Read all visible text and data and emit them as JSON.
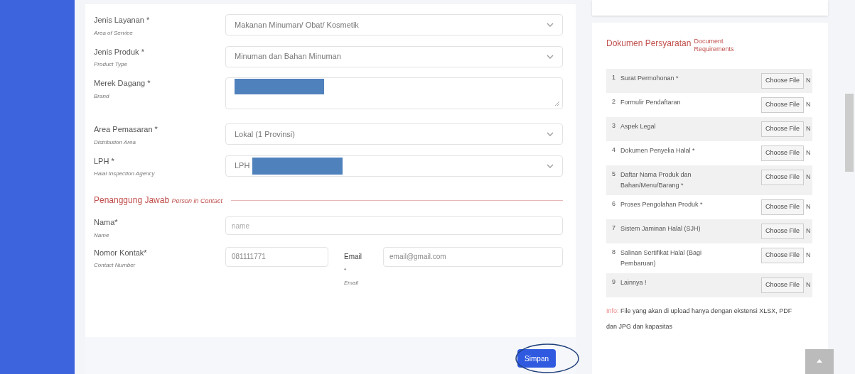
{
  "form": {
    "fields": [
      {
        "kind": "select",
        "label": "Jenis Layanan *",
        "sublabel": "Area of Service",
        "value": "Makanan Minuman/ Obat/ Kosmetik"
      },
      {
        "kind": "select",
        "label": "Jenis Produk *",
        "sublabel": "Product Type",
        "value": "Minuman dan Bahan Minuman"
      },
      {
        "kind": "textarea",
        "label": "Merek Dagang *",
        "sublabel": "Brand",
        "redacted": true
      },
      {
        "kind": "select",
        "label": "Area Pemasaran *",
        "sublabel": "Distribution Area",
        "value": "Lokal (1 Provinsi)"
      },
      {
        "kind": "select",
        "label": "LPH *",
        "sublabel": "Halal Inspection Agency",
        "value": "LPH",
        "redacted": true
      }
    ],
    "section": {
      "title": "Penanggung Jawab",
      "subtitle": "Person in Contact"
    },
    "contact": {
      "name": {
        "label": "Nama*",
        "sublabel": "Name",
        "placeholder": "name"
      },
      "phone": {
        "label": "Nomor Kontak*",
        "sublabel": "Contact Number",
        "value": "081111771"
      },
      "email": {
        "label": "Email",
        "star": "*",
        "sublabel": "Email",
        "value": "email@gmail.com"
      }
    },
    "submit": "Simpan"
  },
  "documents": {
    "title": "Dokumen Persyaratan",
    "subtitle": "Document Requirements",
    "rows": [
      {
        "number": "1",
        "name": "Surat Permohonan *",
        "button": "Choose File",
        "status": "N"
      },
      {
        "number": "2",
        "name": "Formulir Pendaftaran",
        "button": "Choose File",
        "status": "N"
      },
      {
        "number": "3",
        "name": "Aspek Legal",
        "button": "Choose File",
        "status": "N"
      },
      {
        "number": "4",
        "name": "Dokumen Penyelia Halal *",
        "button": "Choose File",
        "status": "N"
      },
      {
        "number": "5",
        "name": "Daftar Nama Produk dan Bahan/Menu/Barang *",
        "button": "Choose File",
        "status": "N"
      },
      {
        "number": "6",
        "name": "Proses Pengolahan Produk *",
        "button": "Choose File",
        "status": "N"
      },
      {
        "number": "7",
        "name": "Sistem Jaminan Halal (SJH)",
        "button": "Choose File",
        "status": "N"
      },
      {
        "number": "8",
        "name": "Salinan Sertifikat Halal (Bagi Pembaruan)",
        "button": "Choose File",
        "status": "N"
      },
      {
        "number": "9",
        "name": "Lainnya !",
        "button": "Choose File",
        "status": "N"
      }
    ],
    "info_label": "Info:",
    "info": "File yang akan di upload hanya dengan ekstensi XLSX, PDF dan JPG dan kapasitas"
  }
}
